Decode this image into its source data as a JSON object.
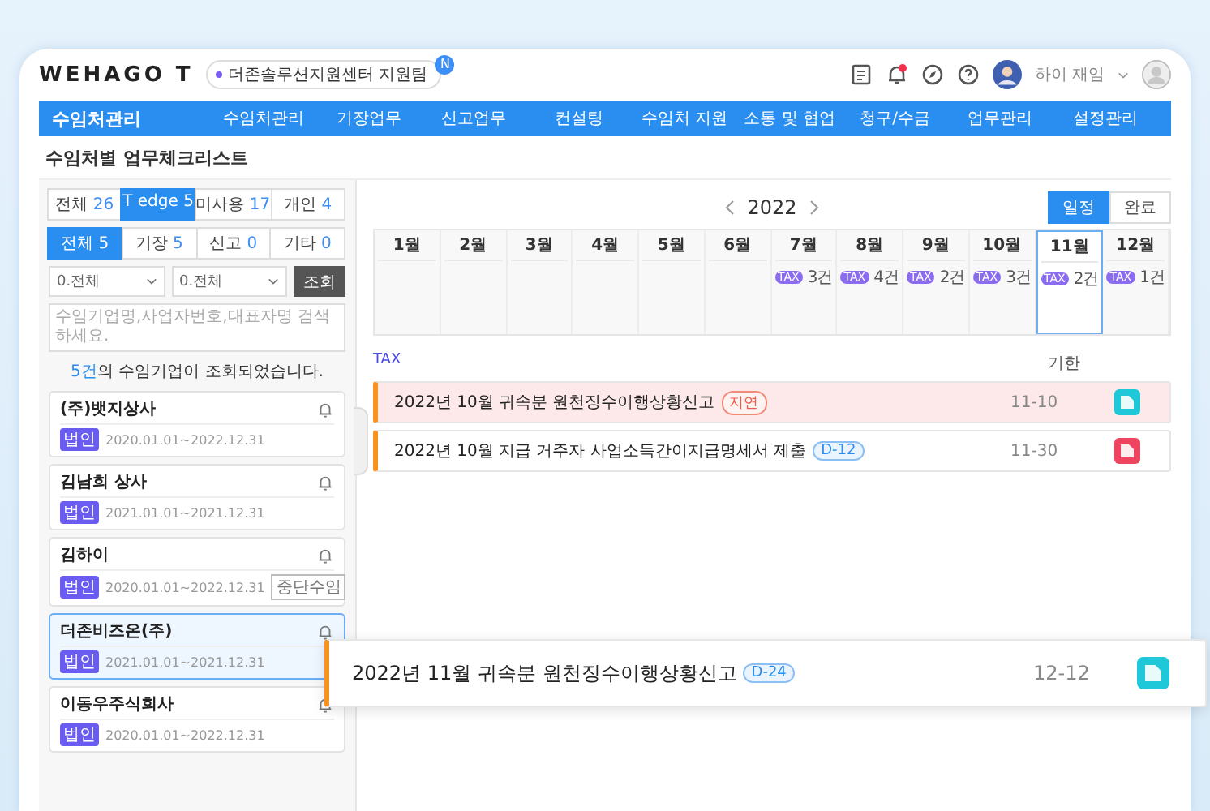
{
  "header": {
    "logo": "WEHAGO T",
    "org_badge": {
      "label": "더존솔루션지원센터 지원팀",
      "mark": "N"
    },
    "user_name": "하이 재임"
  },
  "nav": {
    "title": "수임처관리",
    "items": [
      "수임처관리",
      "기장업무",
      "신고업무",
      "컨설팅",
      "수임처 지원",
      "소통 및 협업",
      "청구/수금",
      "업무관리",
      "설정관리"
    ]
  },
  "page_title": "수임처별 업무체크리스트",
  "sidebar": {
    "type_tabs": [
      {
        "label": "전체",
        "count": "26",
        "selected": false
      },
      {
        "label": "T edge",
        "count": "5",
        "selected": true
      },
      {
        "label": "미사용",
        "count": "17",
        "selected": false
      },
      {
        "label": "개인",
        "count": "4",
        "selected": false
      }
    ],
    "task_tabs": [
      {
        "label": "전체",
        "count": "5",
        "selected": true
      },
      {
        "label": "기장",
        "count": "5",
        "selected": false
      },
      {
        "label": "신고",
        "count": "0",
        "selected": false
      },
      {
        "label": "기타",
        "count": "0",
        "selected": false
      }
    ],
    "selects": [
      "0.전체",
      "0.전체"
    ],
    "search_button": "조회",
    "search": {
      "placeholder": "수임기업명,사업자번호,대표자명 검색 하세요."
    },
    "result": {
      "count": "5건",
      "text": "의 수임기업이 조회되었습니다."
    },
    "clients": [
      {
        "name": "(주)뱃지상사",
        "type": "법인",
        "period": "2020.01.01~2022.12.31",
        "selected": false
      },
      {
        "name": "김남희 상사",
        "type": "법인",
        "period": "2021.01.01~2021.12.31",
        "selected": false
      },
      {
        "name": "김하이",
        "type": "법인",
        "period": "2020.01.01~2022.12.31",
        "status": "중단수임",
        "selected": false
      },
      {
        "name": "더존비즈온(주)",
        "type": "법인",
        "period": "2021.01.01~2021.12.31",
        "selected": true
      },
      {
        "name": "이동우주식회사",
        "type": "법인",
        "period": "2020.01.01~2022.12.31",
        "selected": false
      }
    ]
  },
  "calendar": {
    "year": "2022",
    "view_toggle": [
      {
        "label": "일정",
        "selected": true
      },
      {
        "label": "완료",
        "selected": false
      }
    ],
    "months": [
      {
        "label": "1월",
        "selected": false
      },
      {
        "label": "2월",
        "selected": false
      },
      {
        "label": "3월",
        "selected": false
      },
      {
        "label": "4월",
        "selected": false
      },
      {
        "label": "5월",
        "selected": false
      },
      {
        "label": "6월",
        "selected": false
      },
      {
        "label": "7월",
        "selected": false,
        "tag": "TAX",
        "count": "3건"
      },
      {
        "label": "8월",
        "selected": false,
        "tag": "TAX",
        "count": "4건"
      },
      {
        "label": "9월",
        "selected": false,
        "tag": "TAX",
        "count": "2건"
      },
      {
        "label": "10월",
        "selected": false,
        "tag": "TAX",
        "count": "3건"
      },
      {
        "label": "11월",
        "selected": true,
        "tag": "TAX",
        "count": "2건"
      },
      {
        "label": "12월",
        "selected": false,
        "tag": "TAX",
        "count": "1건"
      }
    ]
  },
  "tasks": {
    "category": "TAX",
    "due_header": "기한",
    "rows": [
      {
        "title": "2022년 10월 귀속분 원천징수이행상황신고",
        "badge": {
          "kind": "overdue",
          "label": "지연"
        },
        "due": "11-10",
        "color": "#1ec8d8"
      },
      {
        "title": "2022년 10월 지급 거주자 사업소득간이지급명세서 제출",
        "badge": {
          "kind": "dday",
          "label": "D-12"
        },
        "due": "11-30",
        "color": "#ef4460"
      }
    ]
  },
  "highlight_task": {
    "title": "2022년 11월 귀속분 원천징수이행상황신고",
    "badge": {
      "kind": "dday",
      "label": "D-24"
    },
    "due": "12-12",
    "color": "#1ec8d8"
  }
}
